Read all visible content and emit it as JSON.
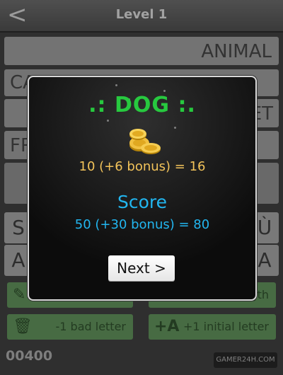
{
  "header": {
    "back_glyph": "<",
    "title": "Level 1"
  },
  "board": {
    "category": "ANIMAL",
    "row2_partial": "CA",
    "row3_partial": "ET",
    "row4_partial": "FR",
    "letters_row1": [
      "S",
      "Ù"
    ],
    "letters_row2": [
      "A",
      "A"
    ]
  },
  "help_buttons": [
    {
      "icon": "eraser-icon",
      "label": ""
    },
    {
      "icon": "length-icon",
      "label": "length"
    },
    {
      "icon": "trash-icon",
      "label": "-1 bad letter"
    },
    {
      "icon": "add-letter-icon",
      "label": "+1 initial letter",
      "icon_text": "+A"
    }
  ],
  "footer": {
    "score": "00400",
    "logo_text": "GAMER24H.COM"
  },
  "modal": {
    "word": ".: DOG :.",
    "coins_text": "10 (+6 bonus) = 16",
    "score_title": "Score",
    "score_text": "50 (+30 bonus) = 80",
    "next_label": "Next >"
  },
  "colors": {
    "word": "#27c93f",
    "coins": "#f2c35a",
    "score": "#22b6f0"
  }
}
